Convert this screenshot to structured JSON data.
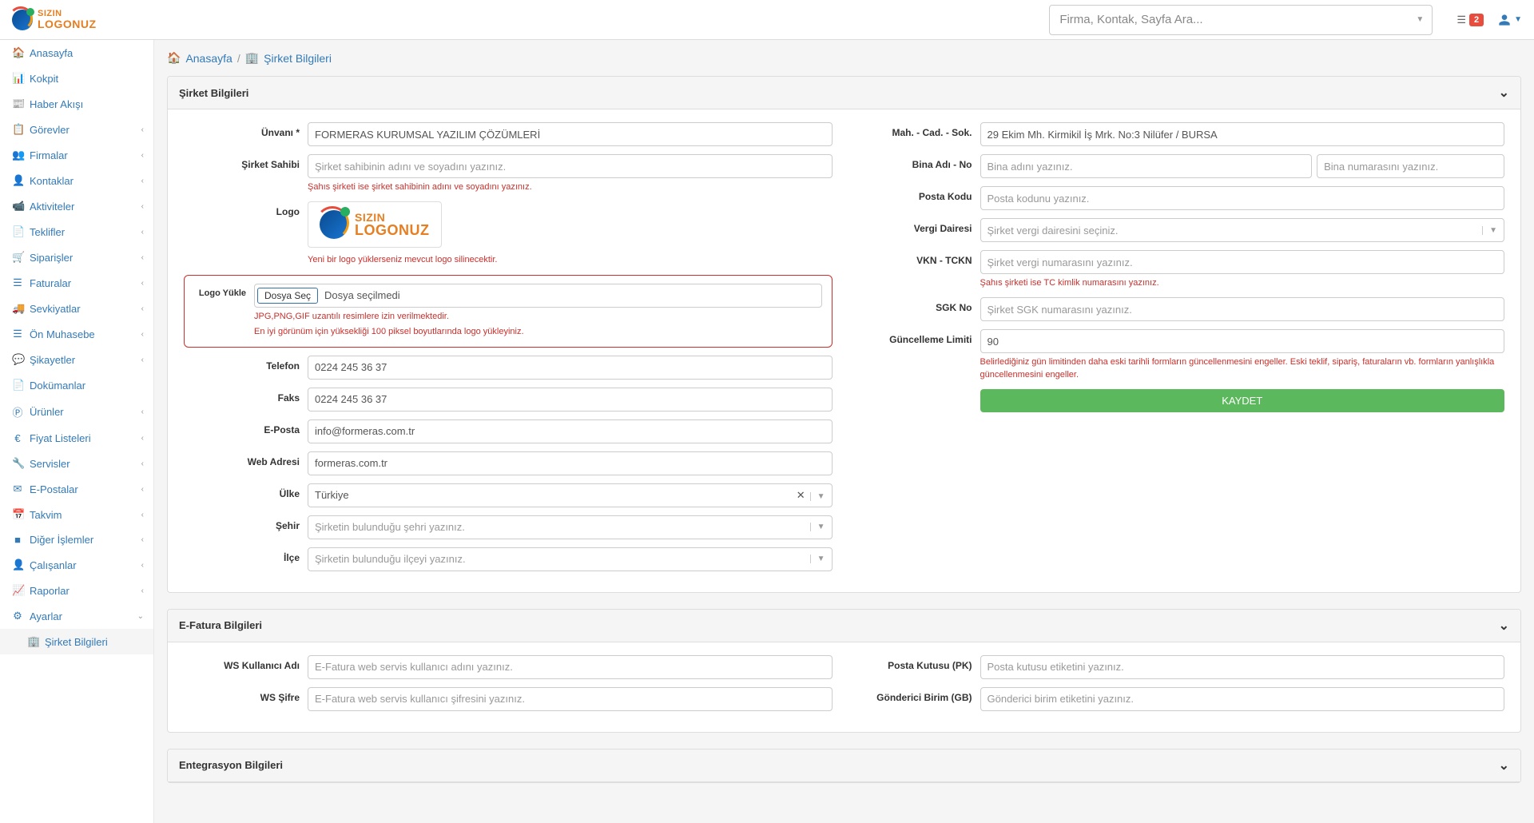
{
  "logoText": {
    "top": "SIZIN",
    "bot": "LOGONUZ"
  },
  "searchPlaceholder": "Firma, Kontak, Sayfa Ara...",
  "notificationCount": "2",
  "sidebar": [
    {
      "icon": "🏠",
      "label": "Anasayfa",
      "expand": false
    },
    {
      "icon": "📊",
      "label": "Kokpit",
      "expand": false
    },
    {
      "icon": "📰",
      "label": "Haber Akışı",
      "expand": false
    },
    {
      "icon": "📋",
      "label": "Görevler",
      "expand": true
    },
    {
      "icon": "👥",
      "label": "Firmalar",
      "expand": true
    },
    {
      "icon": "👤",
      "label": "Kontaklar",
      "expand": true
    },
    {
      "icon": "📹",
      "label": "Aktiviteler",
      "expand": true
    },
    {
      "icon": "📄",
      "label": "Teklifler",
      "expand": true
    },
    {
      "icon": "🛒",
      "label": "Siparişler",
      "expand": true
    },
    {
      "icon": "☰",
      "label": "Faturalar",
      "expand": true
    },
    {
      "icon": "🚚",
      "label": "Sevkiyatlar",
      "expand": true
    },
    {
      "icon": "☰",
      "label": "Ön Muhasebe",
      "expand": true
    },
    {
      "icon": "💬",
      "label": "Şikayetler",
      "expand": true
    },
    {
      "icon": "📄",
      "label": "Dokümanlar",
      "expand": false
    },
    {
      "icon": "Ⓟ",
      "label": "Ürünler",
      "expand": true
    },
    {
      "icon": "€",
      "label": "Fiyat Listeleri",
      "expand": true
    },
    {
      "icon": "🔧",
      "label": "Servisler",
      "expand": true
    },
    {
      "icon": "✉",
      "label": "E-Postalar",
      "expand": true
    },
    {
      "icon": "📅",
      "label": "Takvim",
      "expand": true
    },
    {
      "icon": "■",
      "label": "Diğer İşlemler",
      "expand": true
    },
    {
      "icon": "👤",
      "label": "Çalışanlar",
      "expand": true
    },
    {
      "icon": "📈",
      "label": "Raporlar",
      "expand": true
    },
    {
      "icon": "⚙",
      "label": "Ayarlar",
      "expand": true,
      "open": true
    }
  ],
  "sidebarSub": {
    "icon": "🏢",
    "label": "Şirket Bilgileri"
  },
  "breadcrumb": {
    "home": "Anasayfa",
    "page": "Şirket Bilgileri"
  },
  "panel1": {
    "title": "Şirket Bilgileri",
    "left": {
      "unvan": {
        "label": "Ünvanı *",
        "value": "FORMERAS KURUMSAL YAZILIM ÇÖZÜMLERİ"
      },
      "sahibi": {
        "label": "Şirket Sahibi",
        "placeholder": "Şirket sahibinin adını ve soyadını yazınız.",
        "help": "Şahıs şirketi ise şirket sahibinin adını ve soyadını yazınız."
      },
      "logo": {
        "label": "Logo",
        "help": "Yeni bir logo yüklerseniz mevcut logo silinecektir."
      },
      "logoYukle": {
        "label": "Logo Yükle",
        "btn": "Dosya Seç",
        "text": "Dosya seçilmedi",
        "help1": "JPG,PNG,GIF uzantılı resimlere izin verilmektedir.",
        "help2": "En iyi görünüm için yüksekliği 100 piksel boyutlarında logo yükleyiniz."
      },
      "telefon": {
        "label": "Telefon",
        "value": "0224 245 36 37"
      },
      "faks": {
        "label": "Faks",
        "value": "0224 245 36 37"
      },
      "eposta": {
        "label": "E-Posta",
        "value": "info@formeras.com.tr"
      },
      "web": {
        "label": "Web Adresi",
        "value": "formeras.com.tr"
      },
      "ulke": {
        "label": "Ülke",
        "value": "Türkiye"
      },
      "sehir": {
        "label": "Şehir",
        "placeholder": "Şirketin bulunduğu şehri yazınız."
      },
      "ilce": {
        "label": "İlçe",
        "placeholder": "Şirketin bulunduğu ilçeyi yazınız."
      }
    },
    "right": {
      "mahcad": {
        "label": "Mah. - Cad. - Sok.",
        "value": "29 Ekim Mh. Kirmikil İş Mrk. No:3 Nilüfer / BURSA"
      },
      "bina": {
        "label": "Bina Adı - No",
        "ph1": "Bina adını yazınız.",
        "ph2": "Bina numarasını yazınız."
      },
      "posta": {
        "label": "Posta Kodu",
        "placeholder": "Posta kodunu yazınız."
      },
      "vergi": {
        "label": "Vergi Dairesi",
        "placeholder": "Şirket vergi dairesini seçiniz."
      },
      "vkn": {
        "label": "VKN - TCKN",
        "placeholder": "Şirket vergi numarasını yazınız.",
        "help": "Şahıs şirketi ise TC kimlik numarasını yazınız."
      },
      "sgk": {
        "label": "SGK No",
        "placeholder": "Şirket SGK numarasını yazınız."
      },
      "limit": {
        "label": "Güncelleme Limiti",
        "value": "90",
        "help": "Belirlediğiniz gün limitinden daha eski tarihli formların güncellenmesini engeller. Eski teklif, sipariş, faturaların vb. formların yanlışlıkla güncellenmesini engeller."
      },
      "save": "KAYDET"
    }
  },
  "panel2": {
    "title": "E-Fatura Bilgileri",
    "wsuser": {
      "label": "WS Kullanıcı Adı",
      "placeholder": "E-Fatura web servis kullanıcı adını yazınız."
    },
    "wspass": {
      "label": "WS Şifre",
      "placeholder": "E-Fatura web servis kullanıcı şifresini yazınız."
    },
    "pk": {
      "label": "Posta Kutusu (PK)",
      "placeholder": "Posta kutusu etiketini yazınız."
    },
    "gb": {
      "label": "Gönderici Birim (GB)",
      "placeholder": "Gönderici birim etiketini yazınız."
    }
  },
  "panel3": {
    "title": "Entegrasyon Bilgileri"
  }
}
